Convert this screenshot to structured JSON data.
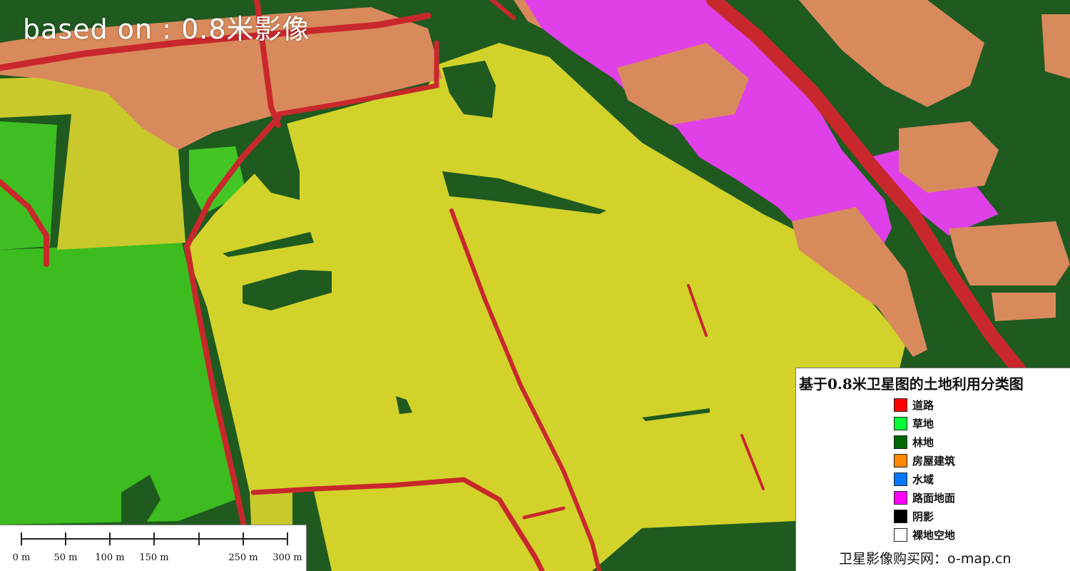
{
  "overlay_caption": "based on : 0.8米影像",
  "legend": {
    "title": "基于0.8米卫星图的土地利用分类图",
    "items": [
      {
        "label": "道路",
        "color": "#ff0000"
      },
      {
        "label": "草地",
        "color": "#00ff33"
      },
      {
        "label": "林地",
        "color": "#006600"
      },
      {
        "label": "房屋建筑",
        "color": "#ff8800"
      },
      {
        "label": "水域",
        "color": "#0077ff"
      },
      {
        "label": "路面地面",
        "color": "#ff00ff"
      },
      {
        "label": "阴影",
        "color": "#000000"
      },
      {
        "label": "裸地空地",
        "color": "#ffffff"
      }
    ],
    "footer": "卫星影像购买网：o-map.cn"
  },
  "scale_bar": {
    "labels": [
      "0 m",
      "50 m",
      "100 m",
      "150 m",
      "250 m",
      "300 m"
    ]
  },
  "map_colors": {
    "cropland": "#d2d22a",
    "grassland": "#3cbc1e",
    "forest": "#1f5a1f",
    "buildings": "#d98a5c",
    "paved": "#e040e8",
    "road": "#c8282c"
  }
}
